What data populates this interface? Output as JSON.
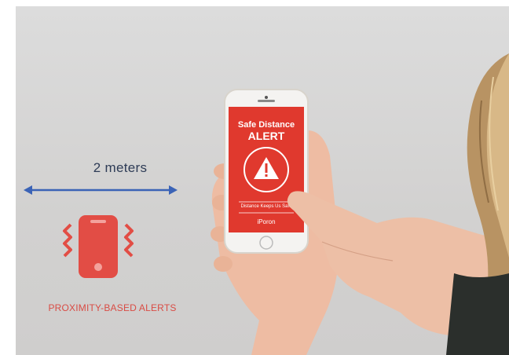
{
  "scene": {
    "distance_label": "2 meters",
    "proximity_label": "PROXIMITY-BASED ALERTS",
    "colors": {
      "arrow": "#3b63b6",
      "alert_red": "#e0392e",
      "phone_icon": "#e24d45",
      "background": "#d6d6d5"
    }
  },
  "phone_screen": {
    "title_line1": "Safe Distance",
    "title_line2": "ALERT",
    "tagline": "Distance Keeps Us Safe",
    "brand": "iPoron",
    "icon": "warning-triangle-icon"
  }
}
